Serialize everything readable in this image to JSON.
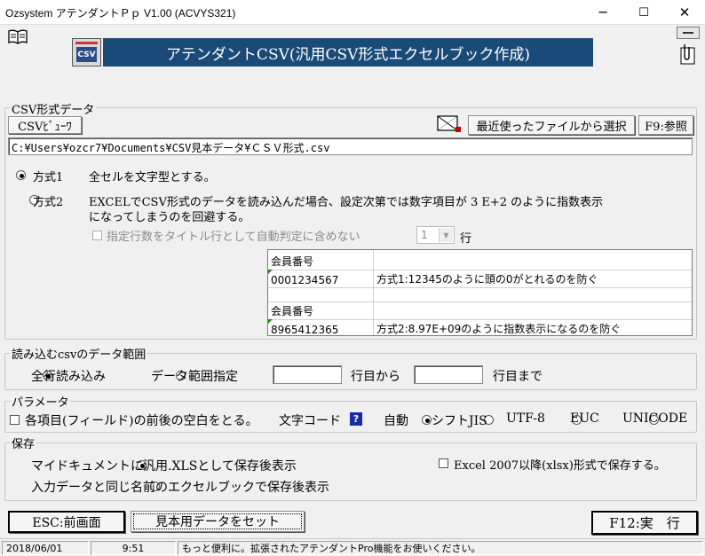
{
  "window": {
    "title": "Ozsystem アテンダントＰｐ V1.00 (ACVYS321)",
    "minimize": "─",
    "maximize": "☐",
    "close": "✕"
  },
  "header": {
    "banner": "アテンダントCSV(汎用CSV形式エクセルブック作成)",
    "csv_icon_label": "CSV"
  },
  "csv_section": {
    "label": "CSV形式データ",
    "viewer_button": "CSVﾋﾞｭｰﾜ",
    "recent_button": "最近使ったファイルから選択",
    "browse_button": "F9:参照",
    "path": "C:¥Users¥ozcr7¥Documents¥CSV見本データ¥ＣＳＶ形式.csv",
    "mode1_label": "方式1",
    "mode1_desc": "全セルを文字型とする。",
    "mode2_label": "方式2",
    "mode2_desc_line1": "EXCELでCSV形式のデータを読み込んだ場合、設定次第では数字項目が 3 E+2 のように指数表示",
    "mode2_desc_line2": "になってしまうのを回避する。",
    "title_rows_label": "指定行数をタイトル行として自動判定に含めない",
    "title_rows_value": "1",
    "title_rows_unit": "行",
    "sample_table": [
      {
        "c1": "会員番号",
        "c2": ""
      },
      {
        "c1": "0001234567",
        "c2": "方式1:12345のように頭の0がとれるのを防ぐ"
      },
      {
        "c1": "",
        "c2": ""
      },
      {
        "c1": "会員番号",
        "c2": ""
      },
      {
        "c1": "8965412365",
        "c2": "方式2:8.97E+09のように指数表示になるのを防ぐ"
      }
    ]
  },
  "range_section": {
    "label": "読み込むcsvのデータ範囲",
    "all_rows": "全行読み込み",
    "specify": "データ範囲指定",
    "from_value": "",
    "from_label": "行目から",
    "to_value": "",
    "to_label": "行目まで"
  },
  "param_section": {
    "label": "パラメータ",
    "trim_label": "各項目(フィールド)の前後の空白をとる。",
    "encoding_label": "文字コード",
    "help_icon": "?",
    "encodings": [
      "自動",
      "シフトJIS",
      "UTF-8",
      "EUC",
      "UNICODE"
    ]
  },
  "save_section": {
    "label": "保存",
    "opt1": "マイドキュメントに汎用.XLSとして保存後表示",
    "opt2": "入力データと同じ名前のエクセルブックで保存後表示",
    "xlsx_label": "Excel 2007以降(xlsx)形式で保存する。"
  },
  "footer": {
    "esc_button": "ESC:前画面",
    "sample_button": "見本用データをセット",
    "run_button": "F12:実　行"
  },
  "status": {
    "date": "2018/06/01",
    "time": "9:51",
    "message": "もっと便利に。拡張されたアテンダントPro機能をお使いください。"
  },
  "colors": {
    "banner": "#1a4a78",
    "accent_help": "#1a2ca8"
  }
}
